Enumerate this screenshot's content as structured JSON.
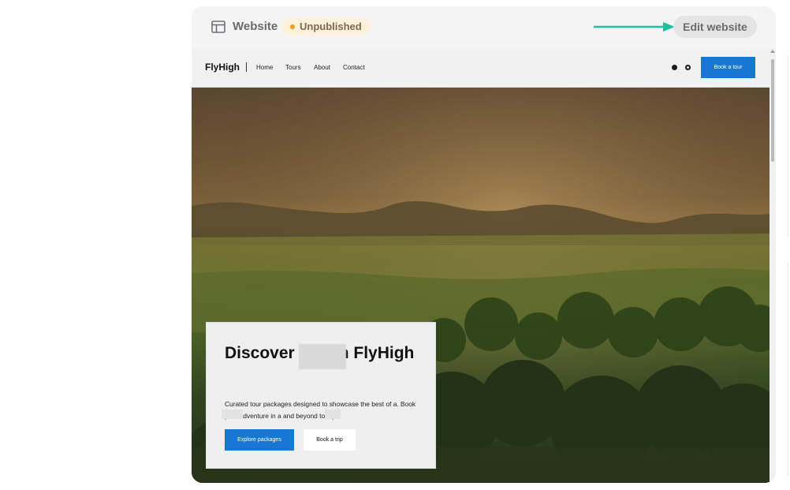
{
  "header": {
    "icon": "layout-icon",
    "title": "Website",
    "status_badge": "Unpublished",
    "edit_button": "Edit website",
    "colors": {
      "badge_bg": "#fdf1d9",
      "badge_dot": "#f19a1c",
      "arrow": "#1fbf9c"
    }
  },
  "site": {
    "brand": "FlyHigh",
    "nav": [
      "Home",
      "Tours",
      "About",
      "Contact"
    ],
    "social_icons": [
      "facebook-icon",
      "instagram-icon"
    ],
    "book_button": "Book a tour",
    "hero": {
      "title": "Discover C      with FlyHigh",
      "description": "Curated tour packages designed to showcase the best of       a. Book your adventure in       a and beyond today.",
      "primary_button": "Explore packages",
      "secondary_button": "Book a trip"
    },
    "colors": {
      "accent": "#1877d2"
    }
  }
}
